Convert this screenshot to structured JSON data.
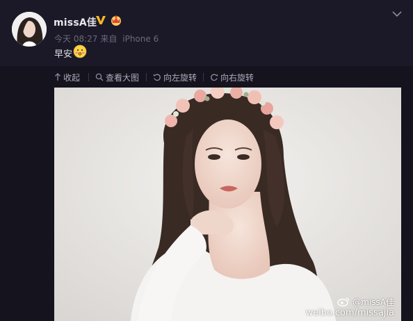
{
  "post": {
    "username": "missA佳",
    "time": "今天 08:27",
    "source_prefix": "来自",
    "source": "iPhone 6",
    "text": "早安"
  },
  "toolbar": {
    "collapse_label": "收起",
    "view_large_label": "查看大图",
    "rotate_left_label": "向左旋转",
    "rotate_right_label": "向右旋转"
  },
  "photo": {
    "watermark_handle": "@missA佳",
    "watermark_url": "weibo.com/missajia"
  },
  "icons": {
    "verified": "verified-v-icon",
    "member": "member-crown-icon",
    "emoji": "shy-face-emoji-icon",
    "menu": "chevron-down-icon",
    "collapse": "arrow-up-icon",
    "view_large": "magnifier-icon",
    "rotate_left": "rotate-left-icon",
    "rotate_right": "rotate-right-icon",
    "weibo_logo": "weibo-logo-icon"
  },
  "colors": {
    "background": "#15131d",
    "header_background": "#1b1927",
    "username": "#e8e8ee",
    "meta_text": "#6b6a7c",
    "toolbar_text": "#aeadbd",
    "verified_gold": "#f5b82b"
  }
}
